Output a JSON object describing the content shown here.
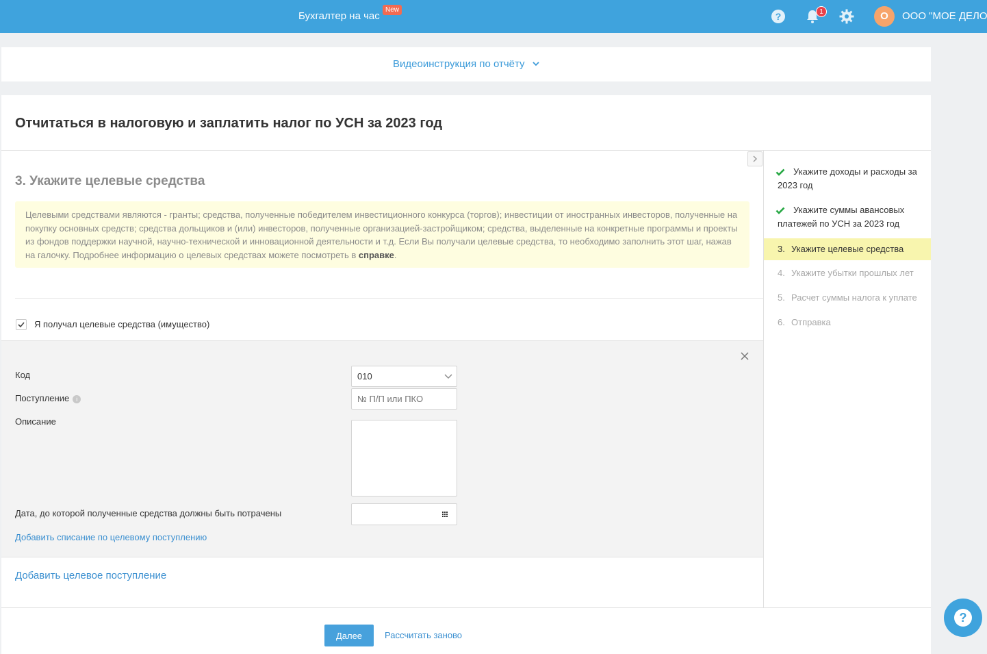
{
  "header": {
    "brand": "Бухгалтер на час",
    "new_badge": "New",
    "notifications_count": "1",
    "avatar_letter": "О",
    "org_name": "ООО \"МОЕ ДЕЛО\""
  },
  "video": {
    "link": "Видеоинструкция по отчёту"
  },
  "page": {
    "title": "Отчитаться в налоговую и заплатить налог по УСН за 2023 год"
  },
  "step": {
    "heading": "3. Укажите целевые средства",
    "info_text": "Целевыми средствами являются - гранты; средства, полученные победителем инвестиционного конкурса (торгов); инвестиции от иностранных инвесторов, полученные на покупку основных средств; средства дольщиков и (или) инвесторов, полученные организацией-застройщиком; средства, выделенные на конкретные программы и проекты из фондов поддержки научной, научно-технической и инновационной деятельности и т.д. Если Вы получали целевые средства, то необходимо заполнить этот шаг, нажав на галочку. Подробнее информацию о целевых средствах можете посмотреть в ",
    "info_link": "справке",
    "info_end": "."
  },
  "form": {
    "received_label": "Я получал целевые средства (имущество)",
    "received_checked": true,
    "code_label": "Код",
    "code_value": "010",
    "receipt_label": "Поступление",
    "receipt_placeholder": "№ П/П или ПКО",
    "description_label": "Описание",
    "date_label": "Дата, до которой полученные средства должны быть потрачены",
    "add_writeoff": "Добавить списание по целевому поступлению",
    "add_target": "Добавить целевое поступление"
  },
  "actions": {
    "next": "Далее",
    "recalc": "Рассчитать заново"
  },
  "sidebar": {
    "steps": [
      {
        "num": "",
        "label": "Укажите доходы и расходы за 2023 год",
        "state": "done"
      },
      {
        "num": "",
        "label": "Укажите суммы авансовых платежей по УСН за 2023 год",
        "state": "done"
      },
      {
        "num": "3.",
        "label": "Укажите целевые средства",
        "state": "active"
      },
      {
        "num": "4.",
        "label": "Укажите убытки прошлых лет",
        "state": "todo"
      },
      {
        "num": "5.",
        "label": "Расчет суммы налога к уплате",
        "state": "todo"
      },
      {
        "num": "6.",
        "label": "Отправка",
        "state": "todo"
      }
    ]
  },
  "colors": {
    "header_bg": "#3fa3dd",
    "link": "#3a8fd0",
    "info_bg": "#fefde0",
    "active_step_bg": "#f8f5ae",
    "done_check": "#27a844",
    "new_badge": "#f26b52",
    "avatar_bg": "#f7a46b"
  }
}
